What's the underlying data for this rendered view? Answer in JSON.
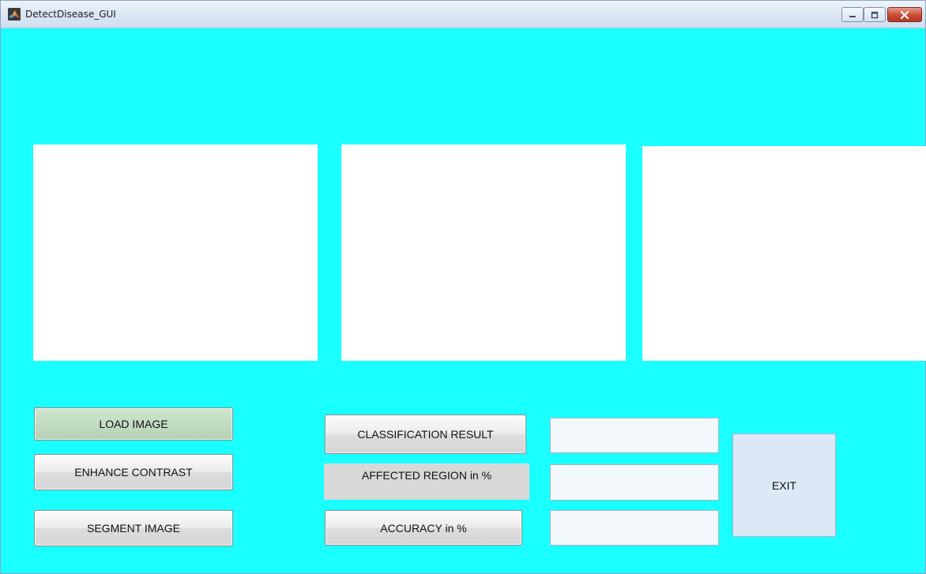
{
  "window": {
    "title": "DetectDisease_GUI",
    "background_color": "#1affff",
    "app_icon": "matlab-icon"
  },
  "controls": {
    "load_image": "LOAD IMAGE",
    "enhance_contrast": "ENHANCE CONTRAST",
    "segment_image": "SEGMENT IMAGE",
    "classification_result": "CLASSIFICATION RESULT",
    "affected_region": "AFFECTED REGION in %",
    "accuracy": "ACCURACY in %",
    "exit": "EXIT"
  },
  "fields": {
    "classification_value": "",
    "affected_region_value": "",
    "accuracy_value": ""
  }
}
